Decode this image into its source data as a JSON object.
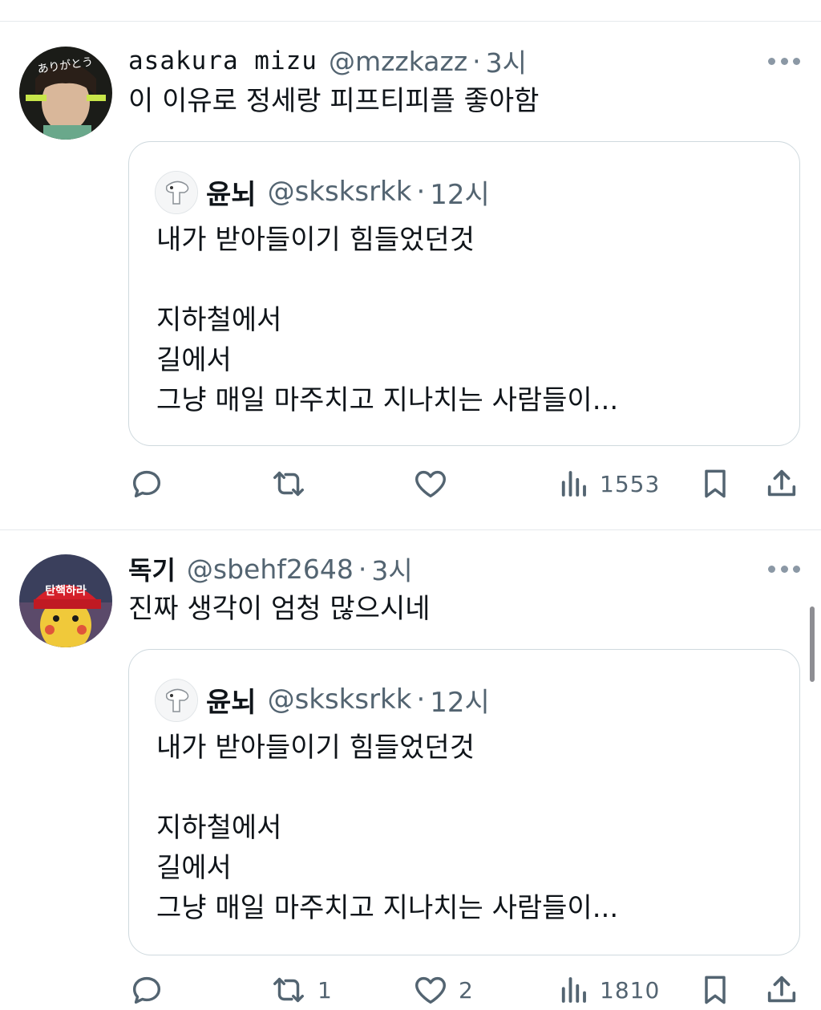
{
  "tweets": [
    {
      "name": "asakura mizu",
      "handle": "@mzzkazz",
      "sep": "·",
      "time": "3시",
      "text": "이 이유로 정세랑 피프티피플 좋아함",
      "avatar_text": "ありがとう",
      "quote": {
        "name": "윤뇌",
        "handle": "@sksksrkk",
        "sep": "·",
        "time": "12시",
        "lines": [
          "내가 받아들이기 힘들었던것",
          "",
          "지하철에서",
          "길에서",
          "그냥 매일 마주치고 지나치는 사람들이..."
        ]
      },
      "stats": {
        "replies": "",
        "retweets": "",
        "likes": "",
        "views": "1553"
      }
    },
    {
      "name": "독기",
      "handle": "@sbehf2648",
      "sep": "·",
      "time": "3시",
      "text": "진짜 생각이 엄청 많으시네",
      "avatar_text": "탄핵하라",
      "quote": {
        "name": "윤뇌",
        "handle": "@sksksrkk",
        "sep": "·",
        "time": "12시",
        "lines": [
          "내가 받아들이기 힘들었던것",
          "",
          "지하철에서",
          "길에서",
          "그냥 매일 마주치고 지나치는 사람들이..."
        ]
      },
      "stats": {
        "replies": "",
        "retweets": "1",
        "likes": "2",
        "views": "1810"
      }
    }
  ],
  "icons": {
    "reply": "reply-icon",
    "retweet": "retweet-icon",
    "like": "heart-icon",
    "views": "views-chart-icon",
    "bookmark": "bookmark-icon",
    "share": "share-icon",
    "more": "more-options-icon"
  },
  "colors": {
    "text": "#0f1419",
    "muted": "#536471",
    "border": "#cfd9de",
    "divider": "#e6e9ec"
  }
}
